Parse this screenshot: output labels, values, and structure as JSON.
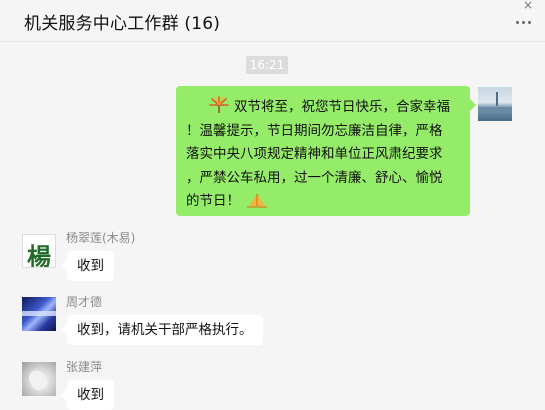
{
  "header": {
    "title": "机关服务中心工作群 (16)",
    "close_label": "×"
  },
  "timestamp": "16:21",
  "my_message": {
    "line1": "双节将至，祝您节日快乐，合家幸福",
    "line2": "！温馨提示，节日期间勿忘廉洁自律，严格",
    "line3": "落实中央八项规定精神和单位正风肃纪要求",
    "line4": "，严禁公车私用，过一个清廉、舒心、愉悦",
    "line5": "的节日！"
  },
  "messages": [
    {
      "sender": "杨翠莲(木易)",
      "avatar_text": "楊",
      "text": "收到"
    },
    {
      "sender": "周才德",
      "avatar_text": "",
      "text": "收到，请机关干部严格执行。"
    },
    {
      "sender": "张建萍",
      "avatar_text": "",
      "text": "收到"
    }
  ],
  "icons": {
    "more": "more-icon",
    "firework": "firework-emoji",
    "hands": "clasped-hands-emoji"
  }
}
